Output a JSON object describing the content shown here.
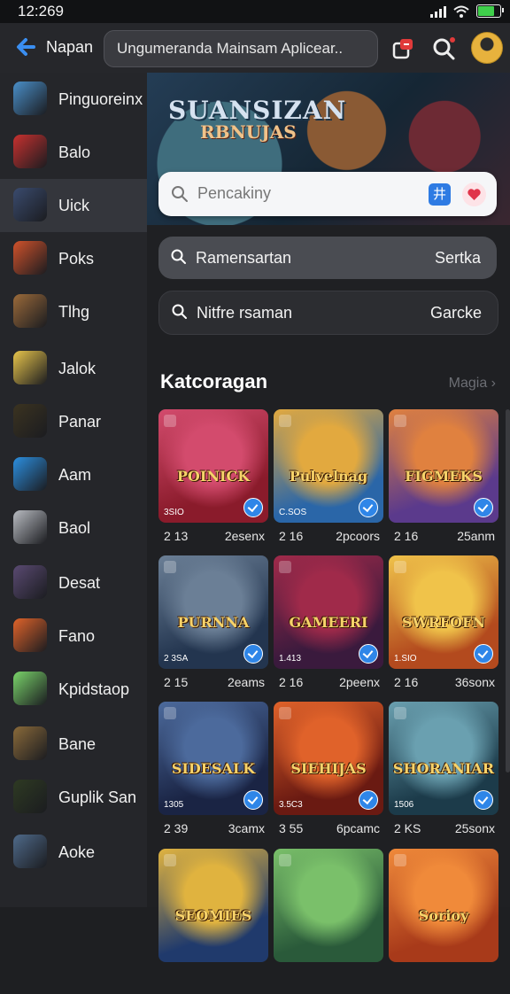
{
  "status": {
    "time": "12:269"
  },
  "header": {
    "title": "Napan",
    "search_value": "Ungumeranda Mainsam Aplicear.."
  },
  "sidebar": {
    "items": [
      {
        "label": "Pinguoreinx",
        "icon": "app-thumb",
        "color": "#4a8fc9"
      },
      {
        "label": "Balo",
        "icon": "app-thumb",
        "color": "#c8312f"
      },
      {
        "label": "Uick",
        "icon": "app-thumb",
        "color": "#3a4b6e",
        "active": true
      },
      {
        "label": "Poks",
        "icon": "app-thumb",
        "color": "#d1522b"
      },
      {
        "label": "Tlhg",
        "icon": "app-thumb",
        "color": "#9b6a3a"
      },
      {
        "label": "Jalok",
        "icon": "app-thumb",
        "color": "#e8c54b"
      },
      {
        "label": "Panar",
        "icon": "app-thumb",
        "color": "#3b3320"
      },
      {
        "label": "Aam",
        "icon": "app-thumb",
        "color": "#2c8fe0"
      },
      {
        "label": "Baol",
        "icon": "app-thumb",
        "color": "#b9bcc2"
      },
      {
        "label": "Desat",
        "icon": "app-thumb",
        "color": "#5a4a72"
      },
      {
        "label": "Fano",
        "icon": "app-thumb",
        "color": "#e0632a"
      },
      {
        "label": "Kpidstaop",
        "icon": "app-thumb",
        "color": "#7ad46a"
      },
      {
        "label": "Bane",
        "icon": "app-thumb",
        "color": "#8a6a3a"
      },
      {
        "label": "Guplik San",
        "icon": "app-thumb",
        "color": "#2e3a22"
      },
      {
        "label": "Aoke",
        "icon": "app-thumb",
        "color": "#4f6a8a"
      }
    ]
  },
  "banner": {
    "title": "SUANSIZAN",
    "subtitle": "RBNUJAS",
    "search_placeholder": "Pencakiny",
    "btn_a_glyph": "井"
  },
  "pills": [
    {
      "label": "Ramensartan",
      "action": "Sertka",
      "bg": "#4a4c52"
    },
    {
      "label": "Nitfre rsaman",
      "action": "Garcke",
      "bg": "#2c2d31"
    }
  ],
  "section": {
    "title": "Katcoragan",
    "more": "Magia"
  },
  "cards": [
    {
      "title": "POINICK",
      "badge": "3SIO",
      "meta": "2 13",
      "meta2": "2esenx",
      "bg1": "#8a1b2b",
      "bg2": "#d34b6d"
    },
    {
      "title": "Pulvelnag",
      "badge": "C.SOS",
      "meta": "2 16",
      "meta2": "2pcoors",
      "bg1": "#2a66a8",
      "bg2": "#e2a93f"
    },
    {
      "title": "FIGMEKS",
      "badge": "",
      "meta": "2 16",
      "meta2": "25anm",
      "bg1": "#5b3a8c",
      "bg2": "#e0813f"
    },
    {
      "title": "PURNNA",
      "badge": "2 3SA",
      "meta": "2 15",
      "meta2": "2eams",
      "bg1": "#23354f",
      "bg2": "#6b7f96"
    },
    {
      "title": "GAMEERI",
      "badge": "1.413",
      "meta": "2 16",
      "meta2": "2peenx",
      "bg1": "#3a1a3d",
      "bg2": "#a02a4a"
    },
    {
      "title": "SWRFOFN",
      "badge": "1.SIO",
      "meta": "2 16",
      "meta2": "36sonx",
      "bg1": "#b34a1e",
      "bg2": "#f0c34a"
    },
    {
      "title": "SIDESALK",
      "badge": "1305",
      "meta": "2 39",
      "meta2": "3camx",
      "bg1": "#1a2444",
      "bg2": "#4c6a9c"
    },
    {
      "title": "SIEHIJAS",
      "badge": "3.5C3",
      "meta": "3 55",
      "meta2": "6pcamc",
      "bg1": "#6a1a12",
      "bg2": "#e0622a"
    },
    {
      "title": "SHORANIAR",
      "badge": "1506",
      "meta": "2 KS",
      "meta2": "25sonx",
      "bg1": "#1c3b4a",
      "bg2": "#6aa0b0"
    },
    {
      "title": "SEOMIES",
      "badge": "",
      "meta": "",
      "meta2": "",
      "bg1": "#203a6c",
      "bg2": "#e0b33f"
    },
    {
      "title": "",
      "badge": "",
      "meta": "",
      "meta2": "",
      "bg1": "#2a5a3a",
      "bg2": "#7ac06a"
    },
    {
      "title": "Sorioy",
      "badge": "",
      "meta": "",
      "meta2": "",
      "bg1": "#a83a1a",
      "bg2": "#f08a3a"
    }
  ]
}
